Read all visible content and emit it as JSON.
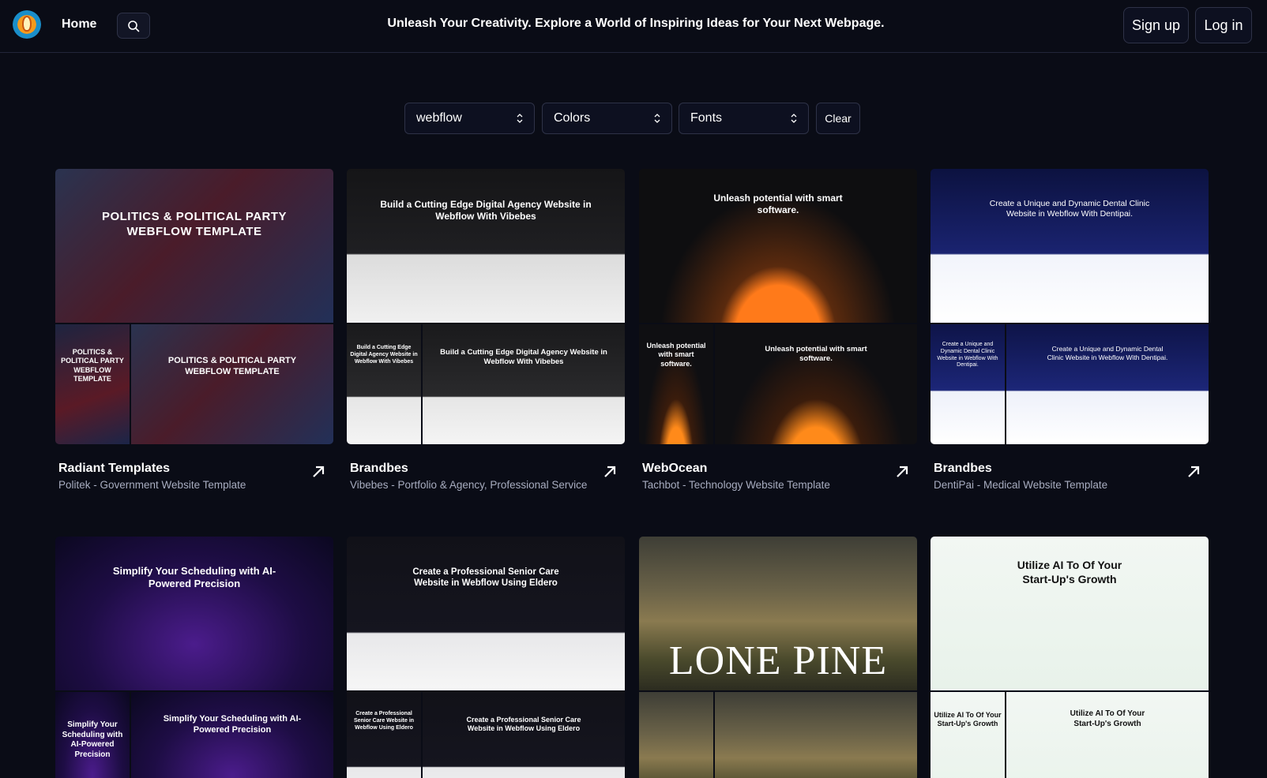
{
  "nav": {
    "home_label": "Home",
    "tagline": "Unleash Your Creativity. Explore a World of Inspiring Ideas for Your Next Webpage.",
    "signup_label": "Sign up",
    "login_label": "Log in"
  },
  "filters": {
    "platform": "webflow",
    "colors": "Colors",
    "fonts": "Fonts",
    "clear_label": "Clear"
  },
  "cards": [
    {
      "author": "Radiant Templates",
      "name": "Politek - Government Website Template",
      "preview_heading": "POLITICS & POLITICAL PARTY WEBFLOW TEMPLATE",
      "preview_small": "POLITICS & POLITICAL PARTY WEBFLOW TEMPLATE"
    },
    {
      "author": "Brandbes",
      "name": "Vibebes - Portfolio & Agency, Professional Service",
      "preview_heading": "Build a Cutting Edge Digital Agency Website in Webflow With Vibebes",
      "preview_small": "Build a Cutting Edge Digital Agency Website in Webflow With Vibebes"
    },
    {
      "author": "WebOcean",
      "name": "Tachbot - Technology Website Template",
      "preview_heading": "Unleash potential with smart software.",
      "preview_small": "Unleash potential with smart software."
    },
    {
      "author": "Brandbes",
      "name": "DentiPai - Medical Website Template",
      "preview_heading": "Create a Unique and Dynamic Dental Clinic Website in Webflow With Dentipai.",
      "preview_small": "Create a Unique and Dynamic Dental Clinic Website in Webflow With Dentipai."
    },
    {
      "author": "",
      "name": "",
      "preview_heading": "Simplify Your Scheduling with AI-Powered Precision",
      "preview_small": "Simplify Your Scheduling with AI-Powered Precision"
    },
    {
      "author": "",
      "name": "",
      "preview_heading": "Create a Professional Senior Care Website in Webflow Using Eldero",
      "preview_small": "Create a Professional Senior Care Website in Webflow Using Eldero"
    },
    {
      "author": "",
      "name": "",
      "preview_heading": "LONE PINE",
      "preview_small": ""
    },
    {
      "author": "",
      "name": "",
      "preview_heading": "Utilize AI To Of Your Start-Up's Growth",
      "preview_small": "Utilize AI To Of Your Start-Up's Growth"
    }
  ],
  "colors": {
    "background": "#0a0c16",
    "border": "#2e3247",
    "muted_text": "#a8adc0",
    "accent_orange": "#f59a1c"
  }
}
